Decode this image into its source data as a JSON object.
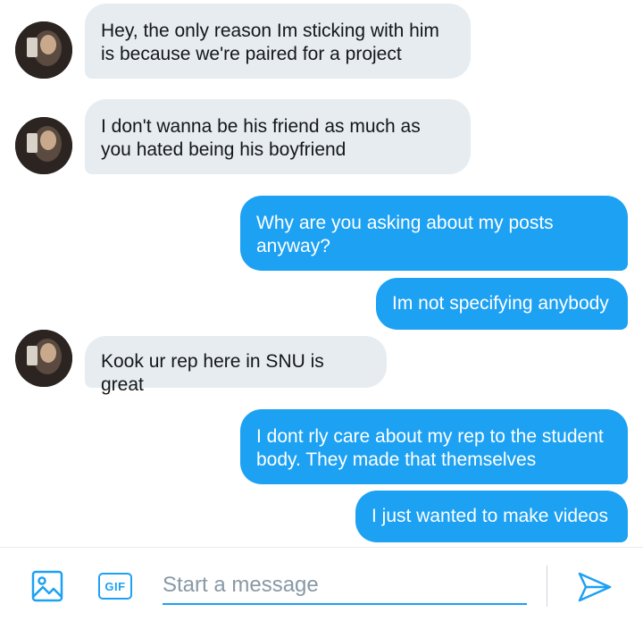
{
  "messages": [
    {
      "from": "them",
      "text": "Hey, the only reason Im sticking with him\nis because we're paired for a project"
    },
    {
      "from": "them",
      "text": "I don't wanna be his friend as much as\nyou hated being his boyfriend"
    },
    {
      "from": "me",
      "text": "Why are you asking about my posts\nanyway?"
    },
    {
      "from": "me",
      "text": "Im not specifying anybody"
    },
    {
      "from": "them",
      "text": "Kook  ur rep here in SNU is great"
    },
    {
      "from": "me",
      "text": "I dont rly care about my rep to the student\nbody. They made that themselves"
    },
    {
      "from": "me",
      "text": "I just wanted to make videos"
    }
  ],
  "composer": {
    "placeholder": "Start a message",
    "gif_label": "GIF",
    "media_icon": "image-icon",
    "send_icon": "send-icon"
  },
  "colors": {
    "accent": "#1da1f2",
    "incoming_bubble": "#e6ecf0",
    "incoming_text": "#14171a",
    "outgoing_text": "#ffffff",
    "placeholder": "#8899a6"
  }
}
